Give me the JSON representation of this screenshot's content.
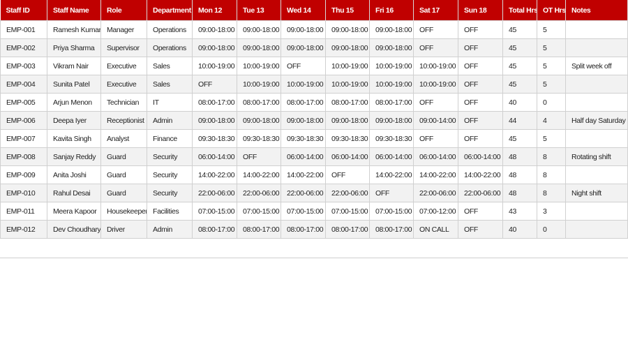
{
  "colors": {
    "header_bg": "#c00000",
    "header_text": "#ffffff",
    "row_alt": "#f2f2f2",
    "grid": "#d0d0d0"
  },
  "columns": [
    "Staff ID",
    "Staff Name",
    "Role",
    "Department",
    "Mon 12",
    "Tue 13",
    "Wed 14",
    "Thu 15",
    "Fri 16",
    "Sat 17",
    "Sun 18",
    "Total Hrs",
    "OT Hrs",
    "Notes"
  ],
  "rows": [
    [
      "EMP-001",
      "Ramesh Kumar",
      "Manager",
      "Operations",
      "09:00-18:00",
      "09:00-18:00",
      "09:00-18:00",
      "09:00-18:00",
      "09:00-18:00",
      "OFF",
      "OFF",
      "45",
      "5",
      ""
    ],
    [
      "EMP-002",
      "Priya Sharma",
      "Supervisor",
      "Operations",
      "09:00-18:00",
      "09:00-18:00",
      "09:00-18:00",
      "09:00-18:00",
      "09:00-18:00",
      "OFF",
      "OFF",
      "45",
      "5",
      ""
    ],
    [
      "EMP-003",
      "Vikram Nair",
      "Executive",
      "Sales",
      "10:00-19:00",
      "10:00-19:00",
      "OFF",
      "10:00-19:00",
      "10:00-19:00",
      "10:00-19:00",
      "OFF",
      "45",
      "5",
      "Split week off"
    ],
    [
      "EMP-004",
      "Sunita Patel",
      "Executive",
      "Sales",
      "OFF",
      "10:00-19:00",
      "10:00-19:00",
      "10:00-19:00",
      "10:00-19:00",
      "10:00-19:00",
      "OFF",
      "45",
      "5",
      ""
    ],
    [
      "EMP-005",
      "Arjun Menon",
      "Technician",
      "IT",
      "08:00-17:00",
      "08:00-17:00",
      "08:00-17:00",
      "08:00-17:00",
      "08:00-17:00",
      "OFF",
      "OFF",
      "40",
      "0",
      ""
    ],
    [
      "EMP-006",
      "Deepa Iyer",
      "Receptionist",
      "Admin",
      "09:00-18:00",
      "09:00-18:00",
      "09:00-18:00",
      "09:00-18:00",
      "09:00-18:00",
      "09:00-14:00",
      "OFF",
      "44",
      "4",
      "Half day Saturday"
    ],
    [
      "EMP-007",
      "Kavita Singh",
      "Analyst",
      "Finance",
      "09:30-18:30",
      "09:30-18:30",
      "09:30-18:30",
      "09:30-18:30",
      "09:30-18:30",
      "OFF",
      "OFF",
      "45",
      "5",
      ""
    ],
    [
      "EMP-008",
      "Sanjay Reddy",
      "Guard",
      "Security",
      "06:00-14:00",
      "OFF",
      "06:00-14:00",
      "06:00-14:00",
      "06:00-14:00",
      "06:00-14:00",
      "06:00-14:00",
      "48",
      "8",
      "Rotating shift"
    ],
    [
      "EMP-009",
      "Anita Joshi",
      "Guard",
      "Security",
      "14:00-22:00",
      "14:00-22:00",
      "14:00-22:00",
      "OFF",
      "14:00-22:00",
      "14:00-22:00",
      "14:00-22:00",
      "48",
      "8",
      ""
    ],
    [
      "EMP-010",
      "Rahul Desai",
      "Guard",
      "Security",
      "22:00-06:00",
      "22:00-06:00",
      "22:00-06:00",
      "22:00-06:00",
      "OFF",
      "22:00-06:00",
      "22:00-06:00",
      "48",
      "8",
      "Night shift"
    ],
    [
      "EMP-011",
      "Meera Kapoor",
      "Housekeeper",
      "Facilities",
      "07:00-15:00",
      "07:00-15:00",
      "07:00-15:00",
      "07:00-15:00",
      "07:00-15:00",
      "07:00-12:00",
      "OFF",
      "43",
      "3",
      ""
    ],
    [
      "EMP-012",
      "Dev Choudhary",
      "Driver",
      "Admin",
      "08:00-17:00",
      "08:00-17:00",
      "08:00-17:00",
      "08:00-17:00",
      "08:00-17:00",
      "ON CALL",
      "OFF",
      "40",
      "0",
      ""
    ]
  ]
}
